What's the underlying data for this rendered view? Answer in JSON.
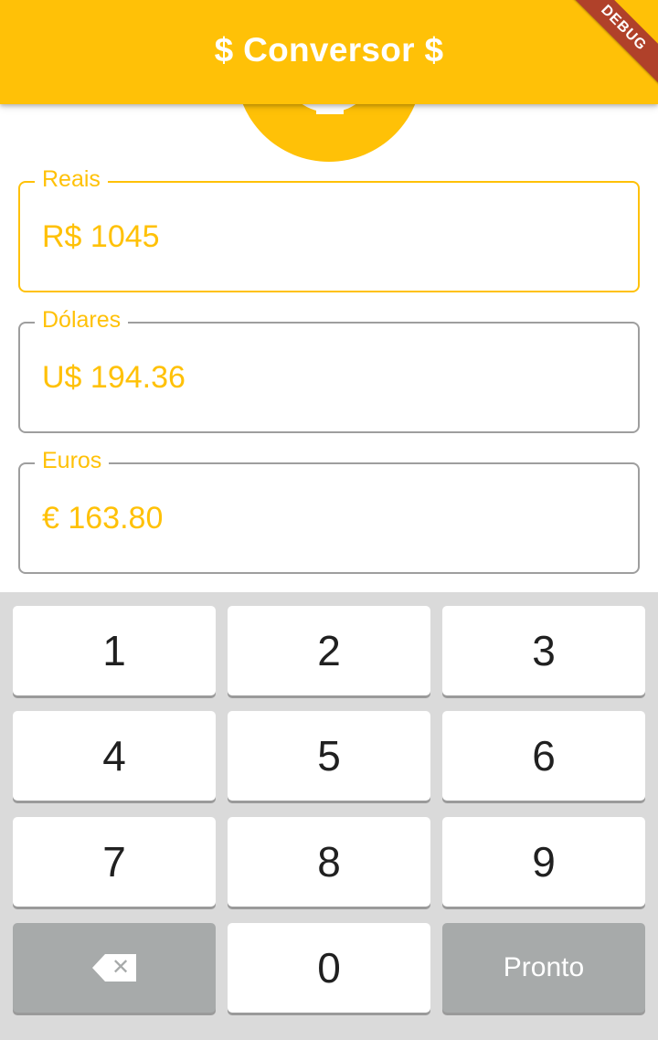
{
  "appbar": {
    "title": "$ Conversor $",
    "debug_banner": "DEBUG"
  },
  "fields": {
    "reais": {
      "label": "Reais",
      "value": "R$ 1045"
    },
    "dolares": {
      "label": "Dólares",
      "value": "U$ 194.36"
    },
    "euros": {
      "label": "Euros",
      "value": "€ 163.80"
    }
  },
  "keyboard": {
    "keys": [
      "1",
      "2",
      "3",
      "4",
      "5",
      "6",
      "7",
      "8",
      "9",
      "0"
    ],
    "backspace_icon": "✕",
    "done_label": "Pronto"
  },
  "colors": {
    "accent": "#FFC107",
    "banner": "#B0412A",
    "keyboard_bg": "#DADADA",
    "function_key": "#A7AAAA"
  },
  "icons": {
    "header_image": "monetization-icon",
    "backspace": "backspace-icon"
  }
}
